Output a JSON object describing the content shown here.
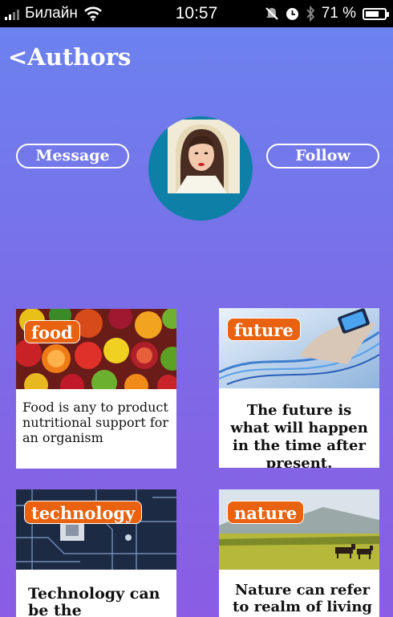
{
  "status_bar": {
    "carrier": "Билайн",
    "time": "10:57",
    "battery": "71 %",
    "battery_level": 0.71
  },
  "header": {
    "back_label": "<Authors"
  },
  "profile": {
    "message_label": "Message",
    "follow_label": "Follow"
  },
  "cards": [
    {
      "tag": "food",
      "text": "Food is any to product nutritional support for an organism"
    },
    {
      "tag": "future",
      "text": "The future is what will happen in the time after present."
    },
    {
      "tag": "technology",
      "text": "Technology can be the knowledge"
    },
    {
      "tag": "nature",
      "text": "Nature can  refer to realm of living"
    }
  ]
}
